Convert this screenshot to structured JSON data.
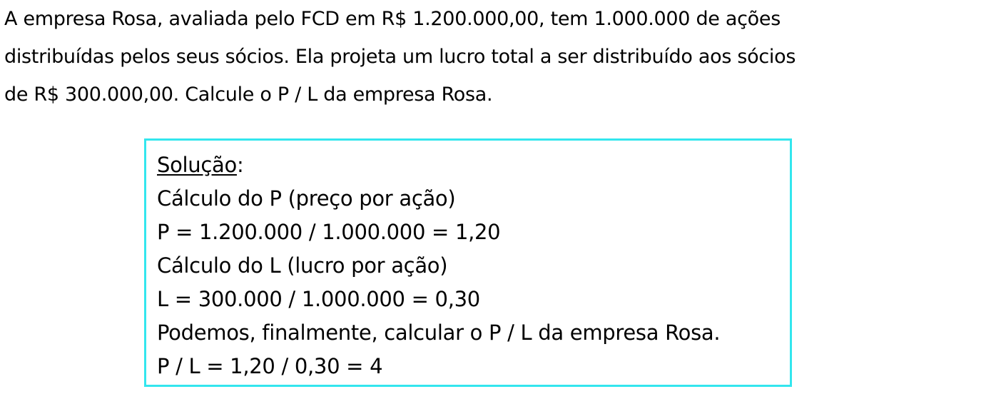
{
  "problem": {
    "lines": [
      "A empresa Rosa, avaliada pelo FCD em R$ 1.200.000,00, tem 1.000.000 de ações",
      "distribuídas pelos seus sócios. Ela projeta um lucro total a ser distribuído aos sócios",
      "de R$ 300.000,00. Calcule o P / L da empresa Rosa."
    ]
  },
  "solution": {
    "heading": "Solução",
    "heading_suffix": ":",
    "lines": [
      "Cálculo do P (preço por ação)",
      "P = 1.200.000 / 1.000.000 = 1,20",
      "Cálculo do L (lucro por ação)",
      "L = 300.000 / 1.000.000 = 0,30",
      "Podemos, finalmente, calcular o P / L da empresa Rosa.",
      "P / L = 1,20 / 0,30 = 4"
    ],
    "border_color": "#33e6ee"
  }
}
